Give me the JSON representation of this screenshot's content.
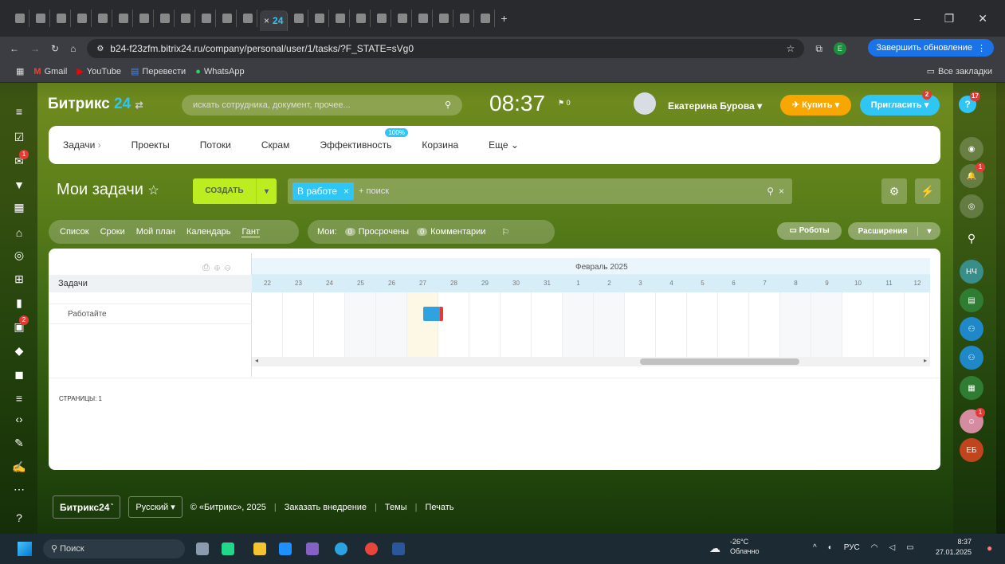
{
  "browser": {
    "tab_label": "24",
    "url": "b24-f23zfm.bitrix24.ru/company/personal/user/1/tasks/?F_STATE=sVg0",
    "update_button": "Завершить обновление",
    "bookmarks": [
      "Gmail",
      "YouTube",
      "Перевести",
      "WhatsApp"
    ],
    "all_bookmarks": "Все закладки"
  },
  "header": {
    "logo_main": "Битрикс",
    "logo_num": "24",
    "search_placeholder": "искать сотрудника, документ, прочее...",
    "time": "08:37",
    "flag_count": "0",
    "user_name": "Екатерина Бурова",
    "buy_label": "Купить",
    "invite_label": "Пригласить",
    "invite_badge": "2",
    "help_badge": "17"
  },
  "nav": {
    "items": [
      "Задачи",
      "Проекты",
      "Потоки",
      "Скрам",
      "Эффективность",
      "Корзина",
      "Еще"
    ],
    "eff_badge": "100%"
  },
  "toolbar": {
    "title": "Мои задачи",
    "create_label": "СОЗДАТЬ",
    "filter_tag": "В работе",
    "filter_placeholder": "+ поиск"
  },
  "views": {
    "tabs": [
      "Список",
      "Сроки",
      "Мой план",
      "Календарь",
      "Гант"
    ],
    "active": "Гант",
    "mine_label": "Мои:",
    "overdue_count": "0",
    "overdue_label": "Просрочены",
    "comments_count": "0",
    "comments_label": "Комментарии",
    "robots_label": "Роботы",
    "ext_label": "Расширения"
  },
  "gantt": {
    "tasks_header": "Задачи",
    "month": "Февраль 2025",
    "days": [
      "22",
      "23",
      "24",
      "25",
      "26",
      "27",
      "28",
      "29",
      "30",
      "31",
      "1",
      "2",
      "3",
      "4",
      "5",
      "6",
      "7",
      "8",
      "9",
      "10",
      "11",
      "12"
    ],
    "task_name": "Работайте",
    "pages_label": "СТРАНИЦЫ: 1"
  },
  "leftbar_badges": [
    "1",
    "2"
  ],
  "rightbar": {
    "avatars": [
      "НЧ",
      "ЕБ"
    ],
    "badges": [
      "1",
      "1"
    ]
  },
  "footer": {
    "logo": "Битрикс24",
    "lang": "Русский",
    "copyright": "© «Битрикс», 2025",
    "links": [
      "Заказать внедрение",
      "Темы",
      "Печать"
    ]
  },
  "taskbar": {
    "search": "Поиск",
    "temp": "-26°C",
    "weather": "Облачно",
    "lang": "РУС",
    "time": "8:37",
    "date": "27.01.2025"
  }
}
